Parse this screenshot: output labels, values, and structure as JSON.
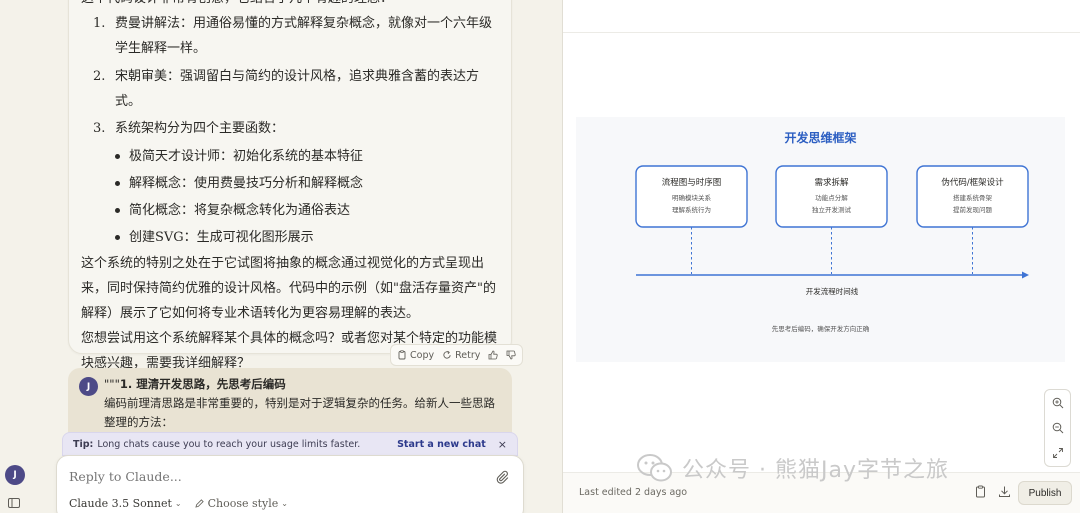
{
  "assistant_message": {
    "intro": "这个代码设计非常有创意，它结合了几个有趣的理念：",
    "ordered_items": [
      {
        "num": "1.",
        "text": "费曼讲解法：用通俗易懂的方式解释复杂概念，就像对一个六年级学生解释一样。"
      },
      {
        "num": "2.",
        "text": "宋朝审美：强调留白与简约的设计风格，追求典雅含蓄的表达方式。"
      },
      {
        "num": "3.",
        "text": "系统架构分为四个主要函数："
      }
    ],
    "bullet_items": [
      "极简天才设计师：初始化系统的基本特征",
      "解释概念：使用费曼技巧分析和解释概念",
      "简化概念：将复杂概念转化为通俗表达",
      "创建SVG：生成可视化图形展示"
    ],
    "paragraph1": "这个系统的特别之处在于它试图将抽象的概念通过视觉化的方式呈现出来，同时保持简约优雅的设计风格。代码中的示例（如\"盘活存量资产\"的解释）展示了它如何将专业术语转化为更容易理解的表达。",
    "paragraph2": "您想尝试用这个系统解释某个具体的概念吗？或者您对某个特定的功能模块感兴趣，需要我详细解释？",
    "actions": {
      "copy": "Copy",
      "retry": "Retry"
    }
  },
  "user_message": {
    "avatar": "J",
    "line1_prefix": "\"\"\"",
    "line1_bold": "1. 理清开发思路，先思考后编码",
    "line2": "编码前理清思路是非常重要的，特别是对于逻辑复杂的任务。给新人一些思路整理的方法："
  },
  "tip": {
    "label": "Tip:",
    "text": "Long chats cause you to reach your usage limits faster.",
    "link": "Start a new chat",
    "close": "×"
  },
  "composer": {
    "placeholder": "Reply to Claude...",
    "model": "Claude 3.5 Sonnet",
    "style": "Choose style"
  },
  "left_avatar": "J",
  "diagram": {
    "title": "开发思维框架",
    "boxes": [
      {
        "title": "流程图与时序图",
        "line1": "明确模块关系",
        "line2": "理解系统行为"
      },
      {
        "title": "需求拆解",
        "line1": "功能点分解",
        "line2": "独立开发测试"
      },
      {
        "title": "伪代码/框架设计",
        "line1": "搭建系统骨架",
        "line2": "提前发现问题"
      }
    ],
    "timeline_label": "开发流程时间线",
    "footnote": "先思考后编码，确保开发方向正确",
    "accent": "#3f74d4",
    "title_color": "#2d5fc2"
  },
  "artifact_footer": {
    "last_edited": "Last edited 2 days ago",
    "publish": "Publish"
  },
  "watermark": {
    "text": "公众号 · 熊猫Jay字节之旅"
  }
}
